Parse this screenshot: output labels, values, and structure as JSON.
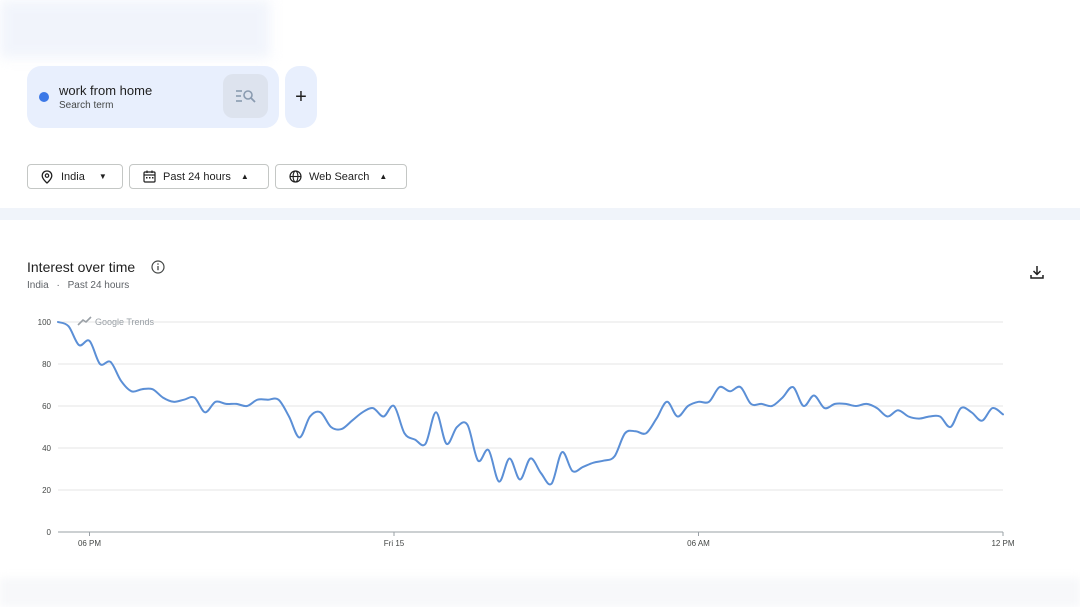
{
  "search_term": {
    "label": "work from home",
    "sublabel": "Search term",
    "color": "#3b78e7"
  },
  "filters": {
    "location": "India",
    "time_range": "Past 24 hours",
    "search_type": "Web Search"
  },
  "panel": {
    "title": "Interest over time",
    "sub_location": "India",
    "sub_separator": "·",
    "sub_time": "Past 24 hours"
  },
  "chart_data": {
    "type": "line",
    "title": "Interest over time",
    "watermark": "Google Trends",
    "xlabel": "",
    "ylabel": "",
    "ylim": [
      0,
      100
    ],
    "yticks": [
      0,
      20,
      40,
      60,
      80,
      100
    ],
    "x_ticks": [
      {
        "label": "06 PM",
        "index": 3
      },
      {
        "label": "Fri 15",
        "index": 32
      },
      {
        "label": "06 AM",
        "index": 61
      },
      {
        "label": "12 PM",
        "index": 90
      }
    ],
    "grid": true,
    "series": [
      {
        "color": "#5b8fd6",
        "values": [
          100,
          98,
          89,
          91,
          80,
          81,
          72,
          67,
          68,
          68,
          64,
          62,
          63,
          64,
          57,
          62,
          61,
          61,
          60,
          63,
          63,
          63,
          55,
          45,
          55,
          57,
          50,
          49,
          53,
          57,
          59,
          55,
          60,
          47,
          44,
          42,
          57,
          42,
          50,
          51,
          34,
          39,
          24,
          35,
          25,
          35,
          28,
          23,
          38,
          29,
          31,
          33,
          34,
          36,
          47,
          48,
          47,
          54,
          62,
          55,
          60,
          62,
          62,
          69,
          67,
          69,
          61,
          61,
          60,
          64,
          69,
          60,
          65,
          59,
          61,
          61,
          60,
          61,
          59,
          55,
          58,
          55,
          54,
          55,
          55,
          50,
          59,
          57,
          53,
          59,
          56
        ]
      }
    ]
  }
}
